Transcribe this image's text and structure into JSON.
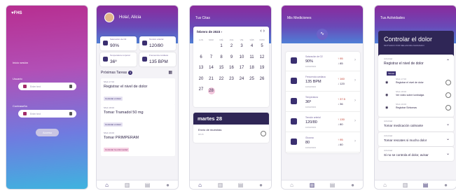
{
  "login": {
    "logo": "FHS",
    "title": "Inicio sesión",
    "user_label": "Usuario",
    "user_placeholder": "Enter text",
    "password_label": "Contraseña",
    "password_placeholder": "Enter text",
    "button": "Acceso"
  },
  "home": {
    "greeting": "Hola!, Alicia",
    "stats": [
      {
        "label": "Saturación de O2",
        "value": "90%"
      },
      {
        "label": "Tensión arterial",
        "value": "120/80"
      },
      {
        "label": "Temperatura corporal",
        "value": "36º"
      },
      {
        "label": "Frecuencia cardiaca",
        "value": "135 BPM"
      }
    ],
    "section": "Próximas Tareas",
    "count": "3",
    "tasks": [
      {
        "time": "5/feb 17:00",
        "name": "Registrar el nivel de dolor",
        "tag": "Controlar el dolor"
      },
      {
        "time": "5/feb 18:00",
        "name": "Tomar Tramadol 50 mg",
        "tag": "Controlar el dolor"
      },
      {
        "time": "5/feb 19:00",
        "name": "Tomar PRIMPERAM",
        "tag": "Controlar la enfermedad"
      }
    ]
  },
  "citas": {
    "title": "Tus Citas",
    "month": "febrero de 2023",
    "weekdays": [
      "LUN",
      "MAR",
      "MIÉ",
      "JUE",
      "VIE",
      "SÁB",
      "DOM"
    ],
    "selected_day": "martes 28",
    "event": "Envío de muestras",
    "event_time": "18:15"
  },
  "mediciones": {
    "title": "Mis Mediciones",
    "rows": [
      {
        "label": "Saturación de O2",
        "value": "90%",
        "date": "10/02/2023",
        "up": "95",
        "down": "85"
      },
      {
        "label": "Frecuencia cardiaca",
        "value": "135 BPM",
        "date": "10/02/2023",
        "up": "160",
        "down": "120"
      },
      {
        "label": "Temperatura",
        "value": "36º",
        "date": "10/02/2023",
        "up": "37.5",
        "down": "36"
      },
      {
        "label": "Tensión arterial",
        "value": "120/80",
        "date": "10/02/2023",
        "up": "130",
        "down": "80"
      },
      {
        "label": "Glucosa",
        "value": "80",
        "date": "10/02/2023",
        "up": "95",
        "down": "80"
      }
    ]
  },
  "actividades": {
    "title": "Tus Actividades",
    "header": "Controlar el dolor",
    "sub": "MOTIVADO POR MELANOMA AVANZADO",
    "expanded_label": "Actividad",
    "expanded_name": "Registrar el nivel de dolor",
    "tag": "Tareas",
    "subtasks": [
      {
        "time": "5/feb 17:00",
        "name": "Registrar el nivel de dolor"
      },
      {
        "time": "5/feb 18:00",
        "name": "Ver video sobre lumbalgia"
      },
      {
        "time": "5/feb 19:00",
        "name": "Registrar Síntomas"
      }
    ],
    "collapsed": [
      {
        "label": "Actividad",
        "name": "Tomar medicación calmante"
      },
      {
        "label": "Actividad",
        "name": "Tomar rescates si mucho dolor"
      },
      {
        "label": "Actividad",
        "name": "Si no se controla el dolor, avisar"
      }
    ]
  }
}
